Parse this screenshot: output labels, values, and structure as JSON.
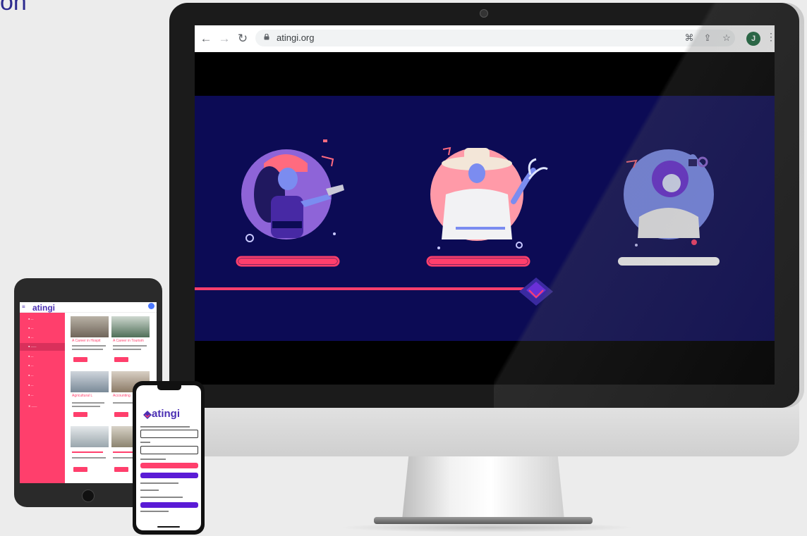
{
  "corner_fragment": "on",
  "desktop": {
    "browser": {
      "url": "atingi.org",
      "profile_initial": "J",
      "icons": [
        "back-arrow-icon",
        "forward-arrow-icon",
        "reload-icon",
        "lock-icon",
        "translate-icon",
        "share-icon",
        "star-icon",
        "kebab-menu-icon"
      ]
    },
    "hero": {
      "background_color": "#0c0b55",
      "accent_color": "#ff3f6c",
      "illustrations": [
        "mechanic-illustration",
        "farmer-illustration",
        "woman-illustration"
      ]
    }
  },
  "tablet": {
    "logo": "atingi",
    "cards": [
      {
        "title": "A Career in Hospit"
      },
      {
        "title": "A Career in Tourism"
      },
      {
        "title": "Agricultural L"
      },
      {
        "title": "Accounting"
      }
    ]
  },
  "phone": {
    "logo": "atingi"
  }
}
